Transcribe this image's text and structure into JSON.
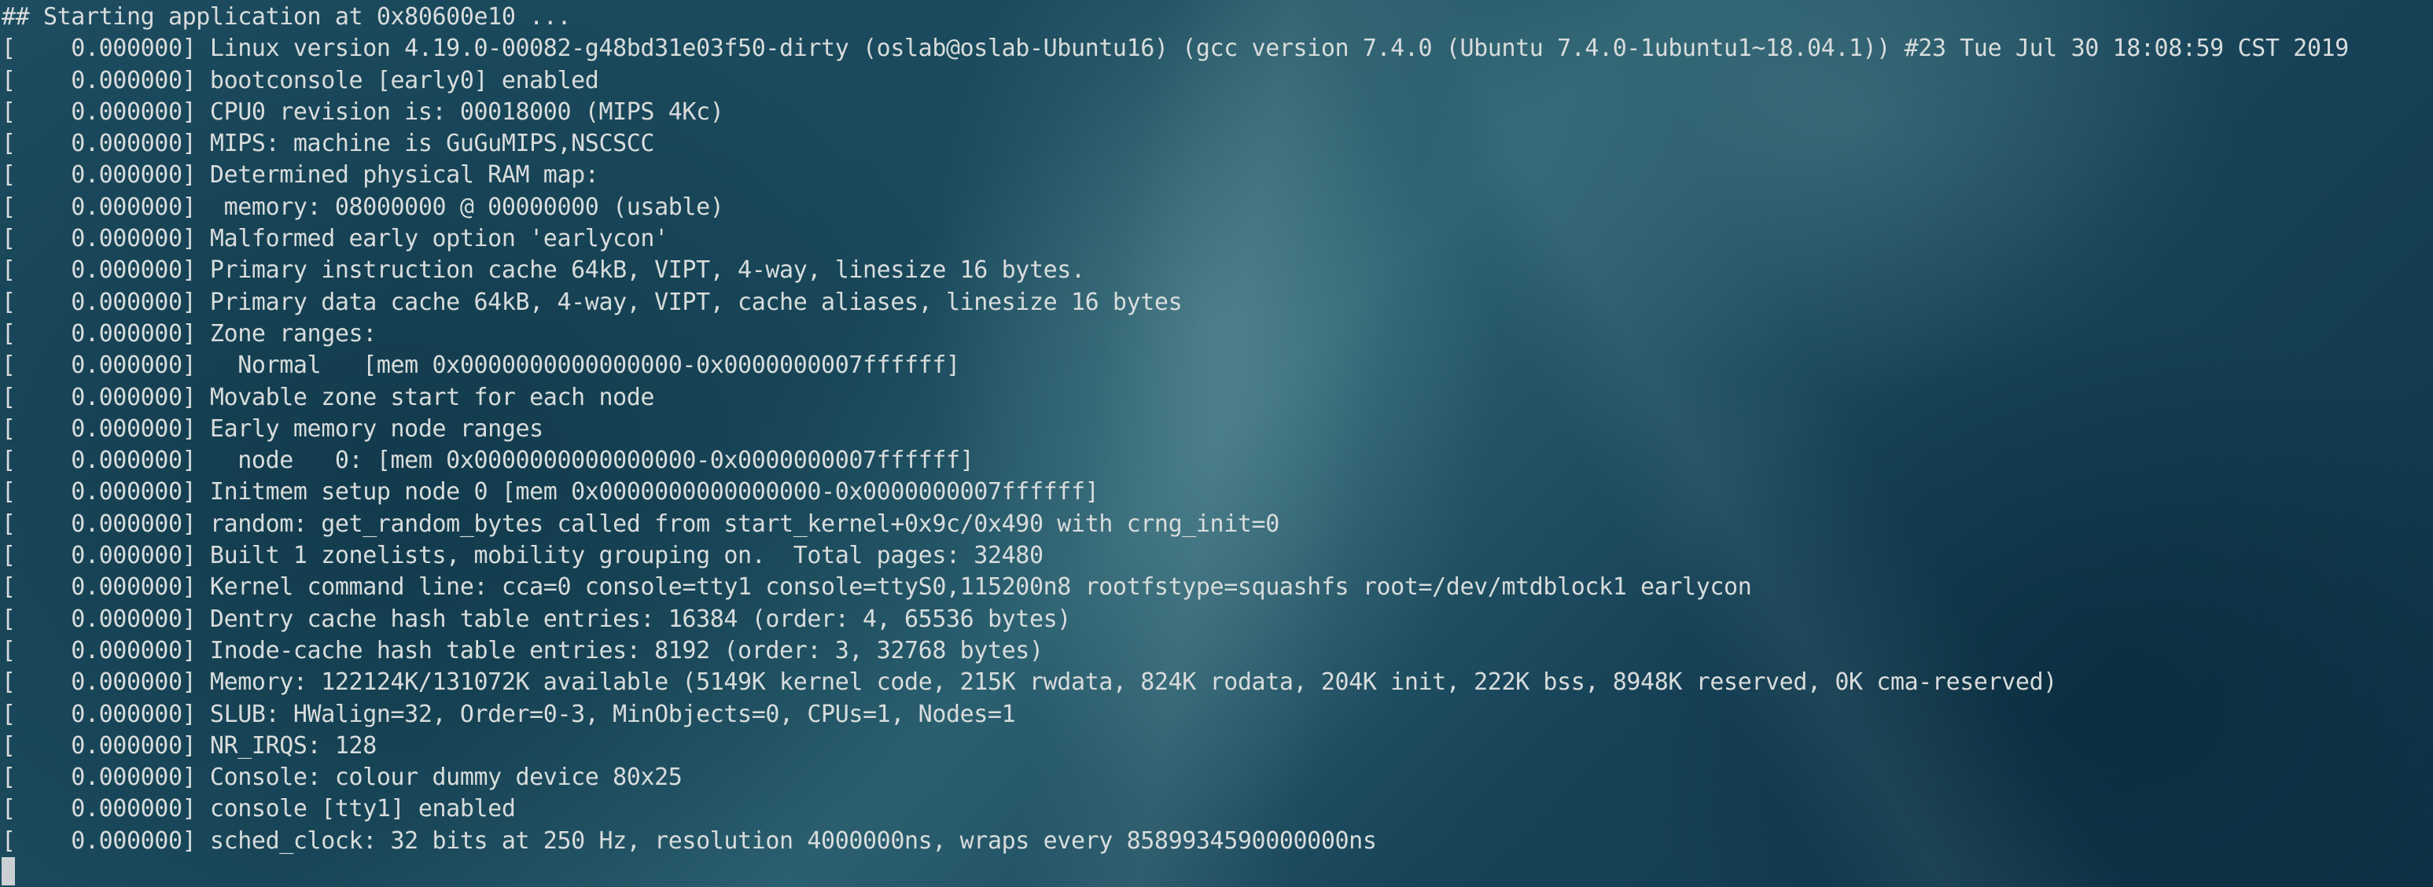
{
  "terminal": {
    "lines": [
      "## Starting application at 0x80600e10 ...",
      "[    0.000000] Linux version 4.19.0-00082-g48bd31e03f50-dirty (oslab@oslab-Ubuntu16) (gcc version 7.4.0 (Ubuntu 7.4.0-1ubuntu1~18.04.1)) #23 Tue Jul 30 18:08:59 CST 2019",
      "[    0.000000] bootconsole [early0] enabled",
      "[    0.000000] CPU0 revision is: 00018000 (MIPS 4Kc)",
      "[    0.000000] MIPS: machine is GuGuMIPS,NSCSCC",
      "[    0.000000] Determined physical RAM map:",
      "[    0.000000]  memory: 08000000 @ 00000000 (usable)",
      "[    0.000000] Malformed early option 'earlycon'",
      "[    0.000000] Primary instruction cache 64kB, VIPT, 4-way, linesize 16 bytes.",
      "[    0.000000] Primary data cache 64kB, 4-way, VIPT, cache aliases, linesize 16 bytes",
      "[    0.000000] Zone ranges:",
      "[    0.000000]   Normal   [mem 0x0000000000000000-0x0000000007ffffff]",
      "[    0.000000] Movable zone start for each node",
      "[    0.000000] Early memory node ranges",
      "[    0.000000]   node   0: [mem 0x0000000000000000-0x0000000007ffffff]",
      "[    0.000000] Initmem setup node 0 [mem 0x0000000000000000-0x0000000007ffffff]",
      "[    0.000000] random: get_random_bytes called from start_kernel+0x9c/0x490 with crng_init=0",
      "[    0.000000] Built 1 zonelists, mobility grouping on.  Total pages: 32480",
      "[    0.000000] Kernel command line: cca=0 console=tty1 console=ttyS0,115200n8 rootfstype=squashfs root=/dev/mtdblock1 earlycon",
      "[    0.000000] Dentry cache hash table entries: 16384 (order: 4, 65536 bytes)",
      "[    0.000000] Inode-cache hash table entries: 8192 (order: 3, 32768 bytes)",
      "[    0.000000] Memory: 122124K/131072K available (5149K kernel code, 215K rwdata, 824K rodata, 204K init, 222K bss, 8948K reserved, 0K cma-reserved)",
      "[    0.000000] SLUB: HWalign=32, Order=0-3, MinObjects=0, CPUs=1, Nodes=1",
      "[    0.000000] NR_IRQS: 128",
      "[    0.000000] Console: colour dummy device 80x25",
      "[    0.000000] console [tty1] enabled",
      "[    0.000000] sched_clock: 32 bits at 250 Hz, resolution 4000000ns, wraps every 8589934590000000ns"
    ]
  },
  "colors": {
    "text": "#d8dcdc",
    "cursor": "#c9cfd2",
    "background": "#163f52"
  }
}
